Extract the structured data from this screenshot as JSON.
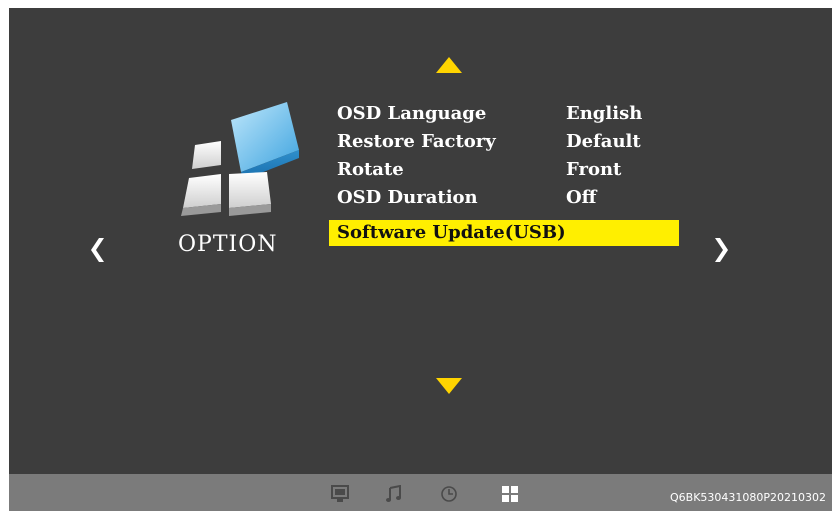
{
  "category": {
    "label": "OPTION",
    "icon": "option-blocks-icon"
  },
  "menu": {
    "items": [
      {
        "label": "OSD Language",
        "value": "English"
      },
      {
        "label": "Restore Factory",
        "value": "Default"
      },
      {
        "label": "Rotate",
        "value": "Front"
      },
      {
        "label": "OSD Duration",
        "value": "Off"
      },
      {
        "label": "Software Update(USB)",
        "value": "",
        "selected": true
      }
    ]
  },
  "navigation": {
    "up": "triangle-up-icon",
    "down": "triangle-down-icon",
    "prev": "chevron-left-icon",
    "next": "chevron-right-icon"
  },
  "bottom_bar": {
    "tabs": [
      "picture-icon",
      "music-icon",
      "clock-icon",
      "option-icon"
    ],
    "active_tab": "option-icon",
    "build_code": "Q6BK530431080P20210302"
  },
  "colors": {
    "background": "#3d3d3d",
    "highlight": "#ffef00",
    "arrow": "#ffd400",
    "bar": "#7b7b7b"
  }
}
